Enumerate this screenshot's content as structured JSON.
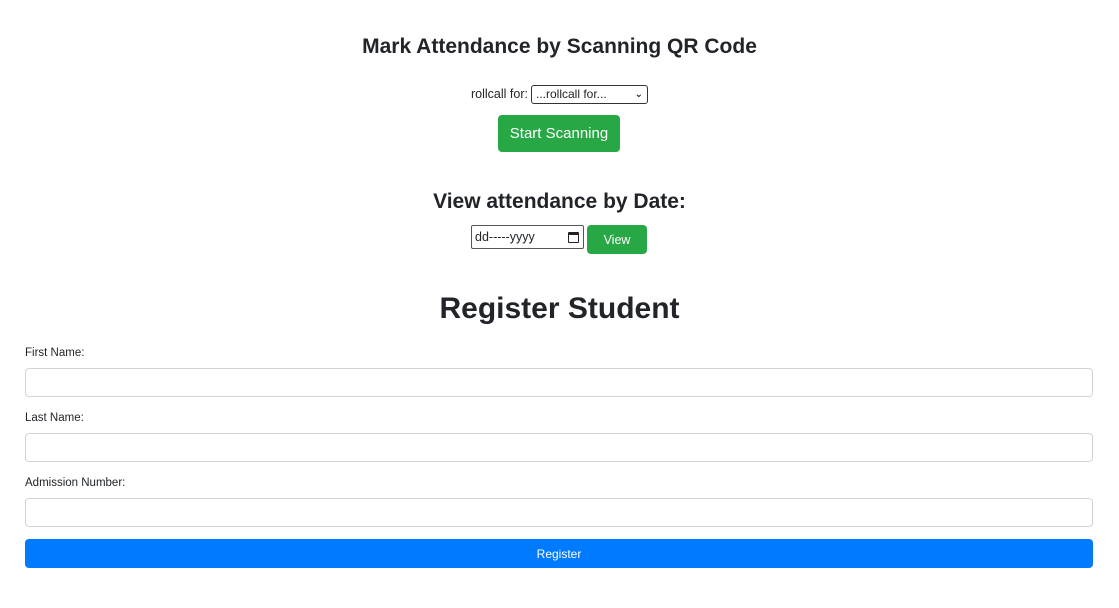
{
  "attendance": {
    "title": "Mark Attendance by Scanning QR Code",
    "rollcall_label": "rollcall for:",
    "rollcall_selected": "...rollcall for...",
    "start_button": "Start Scanning"
  },
  "view": {
    "title": "View attendance by Date:",
    "date_placeholder": "dd-----yyyy",
    "view_button": "View"
  },
  "register": {
    "title": "Register Student",
    "first_name_label": "First Name:",
    "last_name_label": "Last Name:",
    "admission_label": "Admission Number:",
    "first_name_value": "",
    "last_name_value": "",
    "admission_value": "",
    "submit_button": "Register"
  },
  "colors": {
    "green": "#28a745",
    "blue": "#007bff"
  }
}
